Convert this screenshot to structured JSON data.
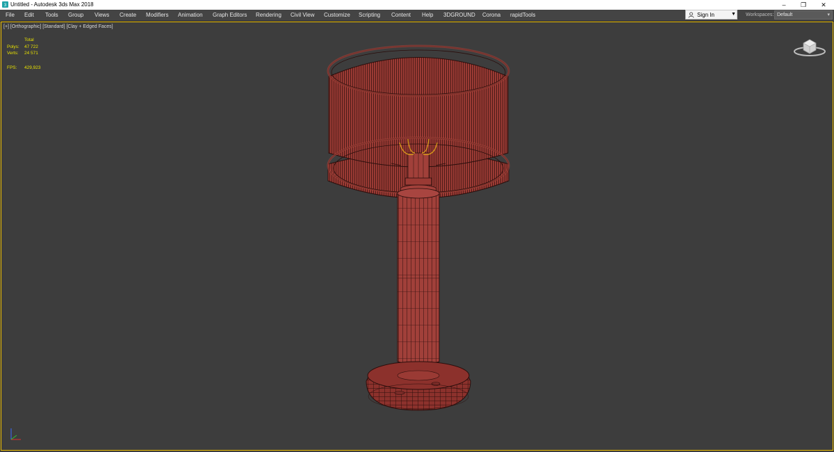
{
  "window": {
    "title": "Untitled - Autodesk 3ds Max 2018",
    "controls": {
      "minimize": "–",
      "maximize": "❐",
      "close": "✕"
    }
  },
  "menu": {
    "items": [
      "File",
      "Edit",
      "Tools",
      "Group",
      "Views",
      "Create",
      "Modifiers",
      "Animation",
      "Graph Editors",
      "Rendering",
      "Civil View",
      "Customize",
      "Scripting",
      "Content",
      "Help",
      "3DGROUND",
      "Corona",
      "rapidTools"
    ]
  },
  "account": {
    "signin_label": "Sign In"
  },
  "workspaces": {
    "label": "Workspaces:",
    "value": "Default"
  },
  "viewport": {
    "label": "[+] [Orthographic] [Standard] [Clay + Edged Faces]",
    "stats": {
      "total_label": "Total",
      "polys_label": "Polys:",
      "polys_value": "47 722",
      "verts_label": "Verts:",
      "verts_value": "24 571",
      "fps_label": "FPS:",
      "fps_value": "429,923"
    }
  },
  "colors": {
    "viewport_bg": "#3d3d3d",
    "active_border": "#f0c000",
    "stats_text": "#e8e100",
    "clay_red": "#9a3a34",
    "wire": "#2a0e0c"
  },
  "icons": {
    "app": "3ds-max-icon",
    "user": "user-icon",
    "viewcube": "viewcube-icon",
    "axis": "axis-tripod-icon"
  }
}
